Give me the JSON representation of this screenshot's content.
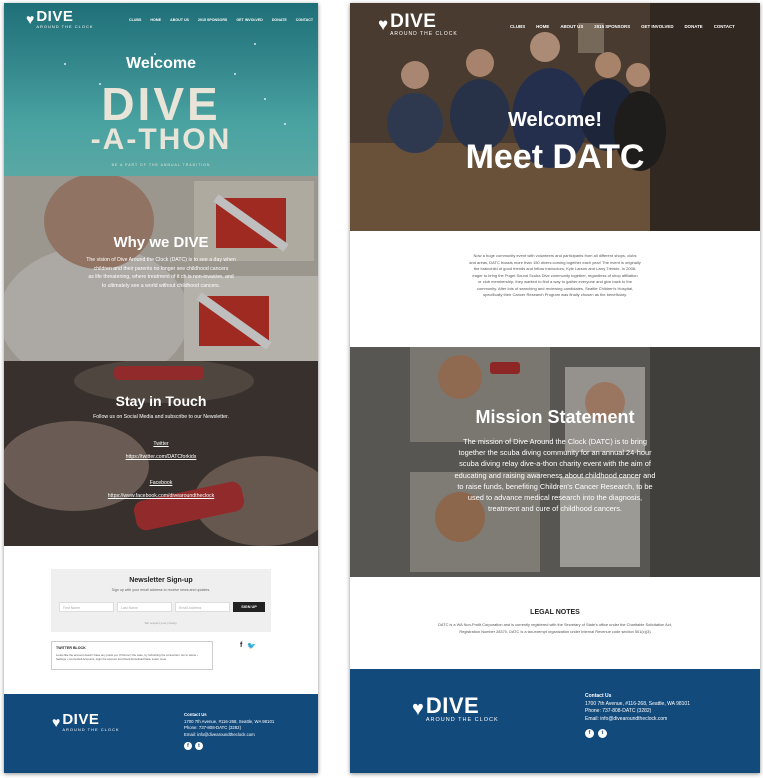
{
  "nav": {
    "logo_word": "DIVE",
    "logo_sub": "AROUND THE CLOCK",
    "items": [
      "CLUBS",
      "HOME",
      "ABOUT US",
      "2015 SPONSORS",
      "GET INVOLVED",
      "DONATE",
      "CONTACT"
    ]
  },
  "left": {
    "hero": {
      "welcome": "Welcome",
      "line1": "DIVE",
      "line2": "-A-THON",
      "tagline": "BE A PART OF THE ANNUAL TRADITION"
    },
    "why": {
      "title": "Why we DIVE",
      "line1": "The vision of Dive Around the Clock (DATC) is to see a day when",
      "line2": "children and their parents no longer see childhood cancers",
      "line3": "as life threatening, where treatment of it ch is non-invasive, and",
      "line4": "to ultimately see a world without childhood cancers."
    },
    "stay": {
      "title": "Stay in Touch",
      "subtitle": "Follow us on Social Media and subscribe to our Newsletter.",
      "twitter_label": "Twitter",
      "twitter_url": "https://twitter.com/DATCforkids",
      "facebook_label": "Facebook",
      "facebook_url": "https://www.facebook.com/divearoundtheclock"
    },
    "newsletter": {
      "title": "Newsletter Sign-up",
      "subtitle": "Sign up with your email address to receive news and updates.",
      "first_name": "First Name",
      "last_name": "Last Name",
      "email": "Email Address",
      "button": "SIGN UP",
      "privacy": "We respect your privacy."
    },
    "twitter_block": {
      "title": "TWITTER BLOCK",
      "body": "Looks like the account doesn't have any posts yet. If this isn't the case, try refreshing the connection. Go to Home › Settings › Connected Accounts, login the account and check Download Data. Learn more"
    }
  },
  "footer": {
    "contact_title": "Contact Us",
    "address": "1700 7th Avenue, #116-268, Seattle, WA 98101",
    "phone": "Phone: 737-808-DATC (3282)",
    "email": "Email: info@divearoundtheclock.com"
  },
  "right": {
    "hero": {
      "welcome": "Welcome!",
      "title": "Meet DATC"
    },
    "intro": {
      "l1": "Now a huge community event with volunteers and participants from all different shops, clubs",
      "l2": "and areas, DATC boasts more than 150 divers coming together each year! The event is originally",
      "l3": "the brainchild of good friends and fellow instructors, Kyle Larson and Larry Trenkle. In 2008,",
      "l4": "eager to bring the Puget Sound Scuba Dive community together, regardless of shop affiliation",
      "l5": "or club membership, they wanted to find a way to gather everyone and give back to the",
      "l6": "community. After lots of searching and reviewing candidates, Seattle Children's Hospital,",
      "l7": "specifically their Cancer Research Program was finally chosen as the beneficiary."
    },
    "mission": {
      "title": "Mission Statement",
      "l1": "The mission of Dive Around the Clock (DATC) is to bring",
      "l2": "together the scuba diving community for an annual 24-hour",
      "l3": "scuba diving relay dive-a-thon charity event with the aim of",
      "l4": "educating and raising awareness about childhood cancer and",
      "l5": "to raise funds, benefiting Children's Cancer Research, to be",
      "l6": "used to advance medical research into the diagnosis,",
      "l7": "treatment and cure of childhood cancers."
    },
    "legal": {
      "title": "LEGAL NOTES",
      "l1": "DATC is a WA Non-Profit Corporation and is currently registered with the Secretary of State's office under the Charitable Solicitation Act,",
      "l2": "Registration Number 28370. DATC is a tax-exempt organization under Internal Revenue code section 501(c)(3)"
    }
  },
  "colors": {
    "footer_blue": "#134a7c",
    "button_dark": "#222222"
  }
}
